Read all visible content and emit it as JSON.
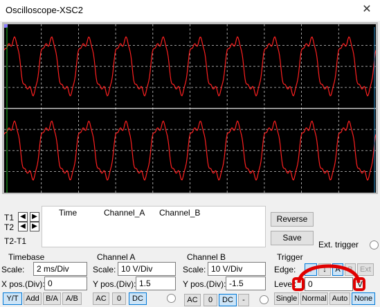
{
  "window": {
    "title": "Oscilloscope-XSC2"
  },
  "readout": {
    "t1_label": "T1",
    "t2_label": "T2",
    "t2t1_label": "T2-T1",
    "col_time": "Time",
    "col_a": "Channel_A",
    "col_b": "Channel_B"
  },
  "actions": {
    "reverse": "Reverse",
    "save": "Save",
    "ext_trigger": "Ext. trigger"
  },
  "timebase": {
    "title": "Timebase",
    "scale_label": "Scale:",
    "scale_value": "2 ms/Div",
    "xpos_label": "X pos.(Div):",
    "xpos_value": "0",
    "modes": [
      "Y/T",
      "Add",
      "B/A",
      "A/B"
    ]
  },
  "channel_a": {
    "title": "Channel A",
    "scale_label": "Scale:",
    "scale_value": "10  V/Div",
    "ypos_label": "Y pos.(Div):",
    "ypos_value": "1.5",
    "coupling": [
      "AC",
      "0",
      "DC"
    ]
  },
  "channel_b": {
    "title": "Channel B",
    "scale_label": "Scale:",
    "scale_value": "10  V/Div",
    "ypos_label": "Y pos.(Div):",
    "ypos_value": "-1.5",
    "coupling": [
      "AC",
      "0",
      "DC",
      "-"
    ]
  },
  "trigger": {
    "title": "Trigger",
    "edge_label": "Edge:",
    "edge_buttons": [
      "A",
      "B",
      "Ext"
    ],
    "level_label": "Level:",
    "level_value": "0",
    "level_unit": "V",
    "modes": [
      "Single",
      "Normal",
      "Auto",
      "None"
    ]
  },
  "colors": {
    "trace": "#ff2020",
    "grid": "#ffffff",
    "screen": "#000000"
  }
}
